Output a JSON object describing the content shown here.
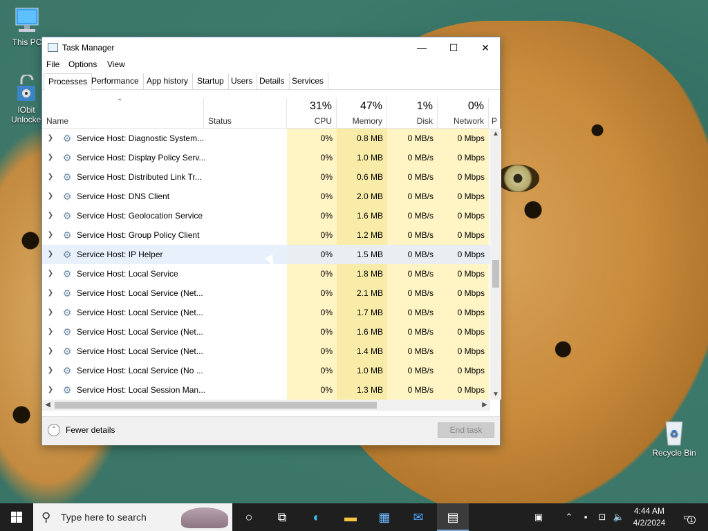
{
  "desktop": {
    "icons": [
      {
        "label": "This PC"
      },
      {
        "label": "IObit Unlocker"
      },
      {
        "label": "Recycle Bin"
      }
    ]
  },
  "window": {
    "title": "Task Manager",
    "controls": {
      "minimize": "—",
      "maximize": "☐",
      "close": "✕"
    },
    "menu": [
      "File",
      "Options",
      "View"
    ],
    "tabs": [
      "Processes",
      "Performance",
      "App history",
      "Startup",
      "Users",
      "Details",
      "Services"
    ],
    "active_tab": "Processes",
    "columns": {
      "name": "Name",
      "status": "Status",
      "cpu": {
        "pct": "31%",
        "label": "CPU"
      },
      "memory": {
        "pct": "47%",
        "label": "Memory"
      },
      "disk": {
        "pct": "1%",
        "label": "Disk"
      },
      "network": {
        "pct": "0%",
        "label": "Network"
      },
      "power": {
        "label": "P"
      }
    },
    "rows": [
      {
        "name": "Service Host: Diagnostic System...",
        "cpu": "0%",
        "memory": "0.8 MB",
        "disk": "0 MB/s",
        "network": "0 Mbps"
      },
      {
        "name": "Service Host: Display Policy Serv...",
        "cpu": "0%",
        "memory": "1.0 MB",
        "disk": "0 MB/s",
        "network": "0 Mbps"
      },
      {
        "name": "Service Host: Distributed Link Tr...",
        "cpu": "0%",
        "memory": "0.6 MB",
        "disk": "0 MB/s",
        "network": "0 Mbps"
      },
      {
        "name": "Service Host: DNS Client",
        "cpu": "0%",
        "memory": "2.0 MB",
        "disk": "0 MB/s",
        "network": "0 Mbps"
      },
      {
        "name": "Service Host: Geolocation Service",
        "cpu": "0%",
        "memory": "1.6 MB",
        "disk": "0 MB/s",
        "network": "0 Mbps"
      },
      {
        "name": "Service Host: Group Policy Client",
        "cpu": "0%",
        "memory": "1.2 MB",
        "disk": "0 MB/s",
        "network": "0 Mbps"
      },
      {
        "name": "Service Host: IP Helper",
        "cpu": "0%",
        "memory": "1.5 MB",
        "disk": "0 MB/s",
        "network": "0 Mbps"
      },
      {
        "name": "Service Host: Local Service",
        "cpu": "0%",
        "memory": "1.8 MB",
        "disk": "0 MB/s",
        "network": "0 Mbps"
      },
      {
        "name": "Service Host: Local Service (Net...",
        "cpu": "0%",
        "memory": "2.1 MB",
        "disk": "0 MB/s",
        "network": "0 Mbps"
      },
      {
        "name": "Service Host: Local Service (Net...",
        "cpu": "0%",
        "memory": "1.7 MB",
        "disk": "0 MB/s",
        "network": "0 Mbps"
      },
      {
        "name": "Service Host: Local Service (Net...",
        "cpu": "0%",
        "memory": "1.6 MB",
        "disk": "0 MB/s",
        "network": "0 Mbps"
      },
      {
        "name": "Service Host: Local Service (Net...",
        "cpu": "0%",
        "memory": "1.4 MB",
        "disk": "0 MB/s",
        "network": "0 Mbps"
      },
      {
        "name": "Service Host: Local Service (No ...",
        "cpu": "0%",
        "memory": "1.0 MB",
        "disk": "0 MB/s",
        "network": "0 Mbps"
      },
      {
        "name": "Service Host: Local Session Man...",
        "cpu": "0%",
        "memory": "1.3 MB",
        "disk": "0 MB/s",
        "network": "0 Mbps"
      }
    ],
    "hover_row_index": 6,
    "footer": {
      "fewer_details": "Fewer details",
      "end_task": "End task"
    }
  },
  "taskbar": {
    "search_placeholder": "Type here to search",
    "time": "4:44 AM",
    "date": "4/2/2024",
    "notification_count": "1"
  },
  "colors": {
    "accent": "#0078d7",
    "cpu_highlight": "#fff4c4",
    "memory_highlight": "#f9eca8",
    "taskbar": "#1f1f1f"
  }
}
